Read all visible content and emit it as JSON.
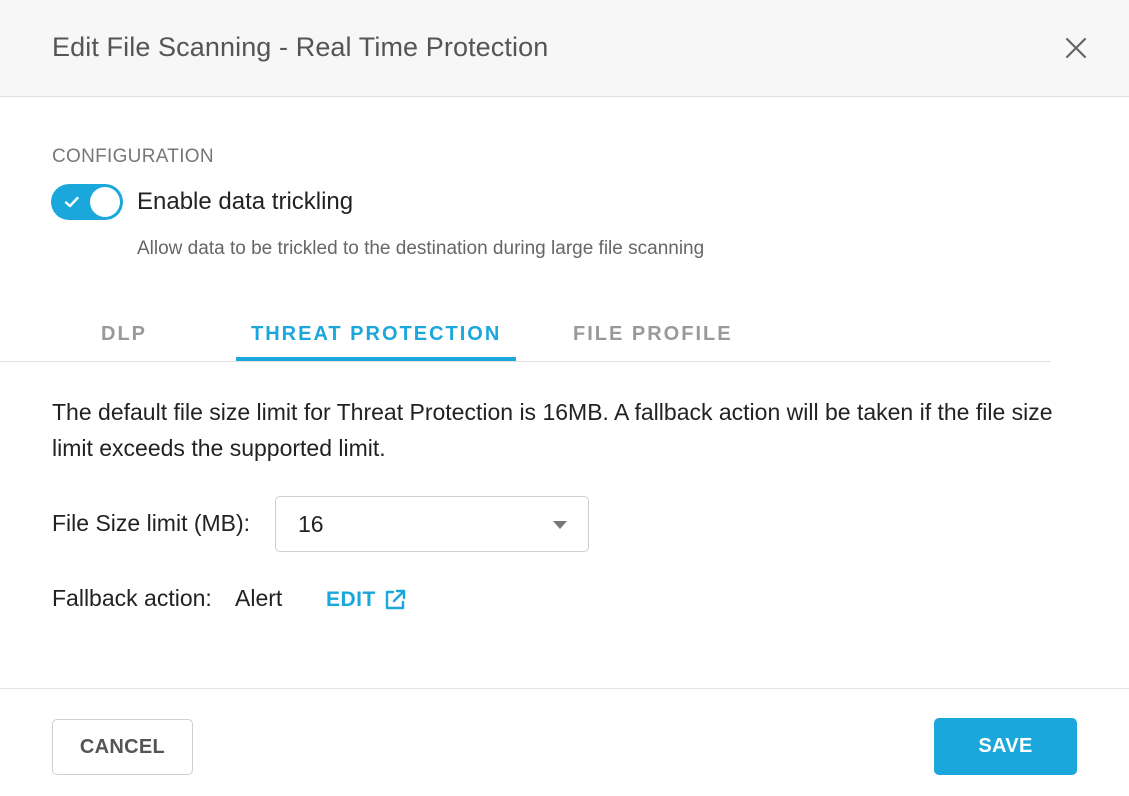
{
  "header": {
    "title": "Edit File Scanning - Real Time Protection",
    "close_icon": "close-icon"
  },
  "configuration": {
    "section_label": "CONFIGURATION",
    "toggle": {
      "label": "Enable data trickling",
      "description": "Allow data to be trickled to the destination during large file scanning",
      "enabled": true
    }
  },
  "tabs": {
    "items": [
      {
        "label": "DLP",
        "active": false
      },
      {
        "label": "THREAT PROTECTION",
        "active": true
      },
      {
        "label": "FILE PROFILE",
        "active": false
      }
    ]
  },
  "threat_protection": {
    "info": "The default file size limit for Threat Protection is 16MB. A fallback action will be taken if the file size limit exceeds the supported limit.",
    "file_size": {
      "label": "File Size limit (MB):",
      "value": "16"
    },
    "fallback": {
      "label": "Fallback action:",
      "value": "Alert",
      "edit_label": "EDIT"
    }
  },
  "footer": {
    "cancel_label": "CANCEL",
    "save_label": "SAVE"
  },
  "colors": {
    "accent": "#1aa7db",
    "header_bg": "#f7f7f7",
    "muted_text": "#777777"
  }
}
